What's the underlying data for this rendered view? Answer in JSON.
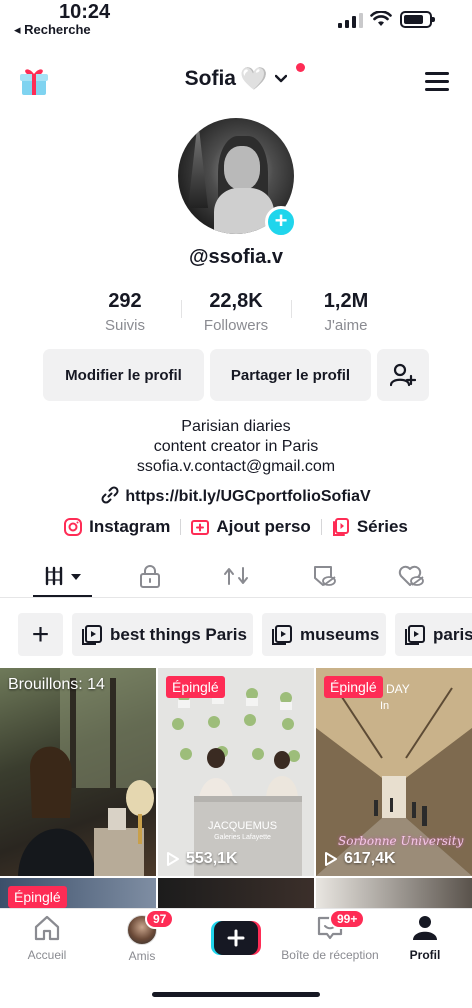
{
  "status_bar": {
    "time": "10:24",
    "back_label": "◂ Recherche"
  },
  "header": {
    "username": "Sofia",
    "heart": "🤍"
  },
  "profile": {
    "handle": "@ssofia.v",
    "stats": [
      {
        "value": "292",
        "label": "Suivis"
      },
      {
        "value": "22,8K",
        "label": "Followers"
      },
      {
        "value": "1,2M",
        "label": "J'aime"
      }
    ],
    "edit_button": "Modifier le profil",
    "share_button": "Partager le profil",
    "bio": [
      "Parisian diaries",
      "content creator in Paris",
      "ssofia.v.contact@gmail.com"
    ],
    "link": "https://bit.ly/UGCportfolioSofiaV",
    "extras": [
      {
        "label": "Instagram",
        "icon": "instagram-icon"
      },
      {
        "label": "Ajout perso",
        "icon": "add-box-icon"
      },
      {
        "label": "Séries",
        "icon": "series-icon"
      }
    ]
  },
  "playlists": [
    "best things Paris",
    "museums",
    "paris"
  ],
  "videos": [
    {
      "overlay": "Brouillons: 14"
    },
    {
      "pinned": "Épinglé",
      "views": "553,1K",
      "caption_lines": [
        "JACQUEMUS",
        "Galeries Lafayette"
      ]
    },
    {
      "pinned": "Épinglé",
      "views": "617,4K",
      "caption_lines": [
        "DAY",
        "In",
        "Sorbonne University"
      ]
    },
    {
      "pinned": "Épinglé"
    }
  ],
  "bottom_nav": {
    "home": "Accueil",
    "friends": "Amis",
    "friends_badge": "97",
    "inbox": "Boîte de réception",
    "inbox_badge": "99+",
    "profile": "Profil"
  },
  "colors": {
    "accent": "#fe2c55",
    "cyan": "#20d5ec",
    "text": "#161823",
    "muted": "#8a8b91"
  }
}
